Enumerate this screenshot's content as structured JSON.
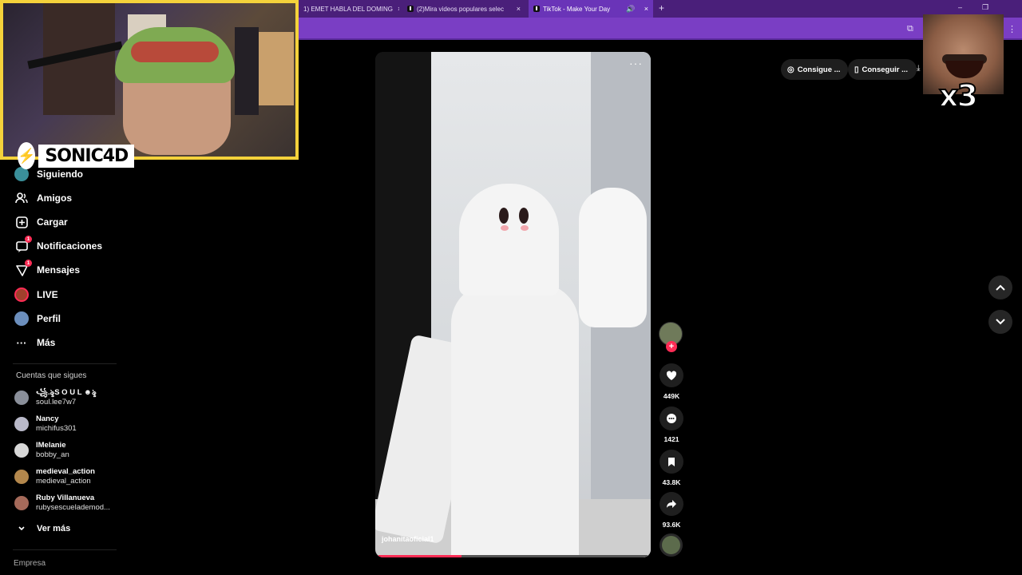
{
  "browser": {
    "tabs": [
      {
        "label": "1) EMET HABLA DEL DOMING",
        "active": false,
        "close": "×"
      },
      {
        "label": "(2)Mira videos populares selec",
        "active": false,
        "close": "×"
      },
      {
        "label": "TikTok - Make Your Day",
        "active": true,
        "close": "×"
      }
    ],
    "new_tab": "+",
    "window_controls": [
      "–",
      "❐"
    ]
  },
  "stream": {
    "brand_name": "SONIC4D",
    "multiplier": "x3"
  },
  "sidebar": {
    "items": [
      {
        "label": "Siguiendo",
        "icon": "following-icon",
        "glyph": "◉"
      },
      {
        "label": "Amigos",
        "icon": "friends-icon",
        "glyph": "👥"
      },
      {
        "label": "Cargar",
        "icon": "upload-icon",
        "glyph": "⊞"
      },
      {
        "label": "Notificaciones",
        "icon": "notifications-icon",
        "glyph": "▭",
        "badge": "1"
      },
      {
        "label": "Mensajes",
        "icon": "messages-icon",
        "glyph": "▽",
        "badge": "1"
      },
      {
        "label": "LIVE",
        "icon": "live-icon",
        "glyph": ""
      },
      {
        "label": "Perfil",
        "icon": "profile-icon",
        "glyph": ""
      },
      {
        "label": "Más",
        "icon": "more-icon",
        "glyph": "···"
      }
    ],
    "following_title": "Cuentas que sigues",
    "accounts": [
      {
        "name": "꧁.ৡS O U L ☻ৡ",
        "handle": "soul.lee7w7",
        "color": "#8a8f9a"
      },
      {
        "name": "Nancy",
        "handle": "michifus301",
        "color": "#b9b9c9"
      },
      {
        "name": "lMelanie",
        "handle": "bobby_an",
        "color": "#d8d8d8"
      },
      {
        "name": "medieval_action",
        "handle": "medieval_action",
        "color": "#b3874c"
      },
      {
        "name": "Ruby Villanueva",
        "handle": "rubysescuelademod...",
        "color": "#a56a5a"
      }
    ],
    "see_more": "Ver más",
    "see_more_icon": "chevron-down-icon",
    "footer": "Empresa"
  },
  "video": {
    "username": "johanitaoficial1",
    "more": "···",
    "progress": 0.31
  },
  "actions": {
    "likes": "449K",
    "comments": "1421",
    "saves": "43.8K",
    "shares": "93.6K",
    "follow_symbol": "+"
  },
  "top_buttons": {
    "get_coins": "Consigue ...",
    "get_app": "Conseguir ..."
  },
  "colors": {
    "accent": "#fe2c55",
    "tab_bar": "#4a1f7a",
    "cam_border": "#f4d23b"
  }
}
